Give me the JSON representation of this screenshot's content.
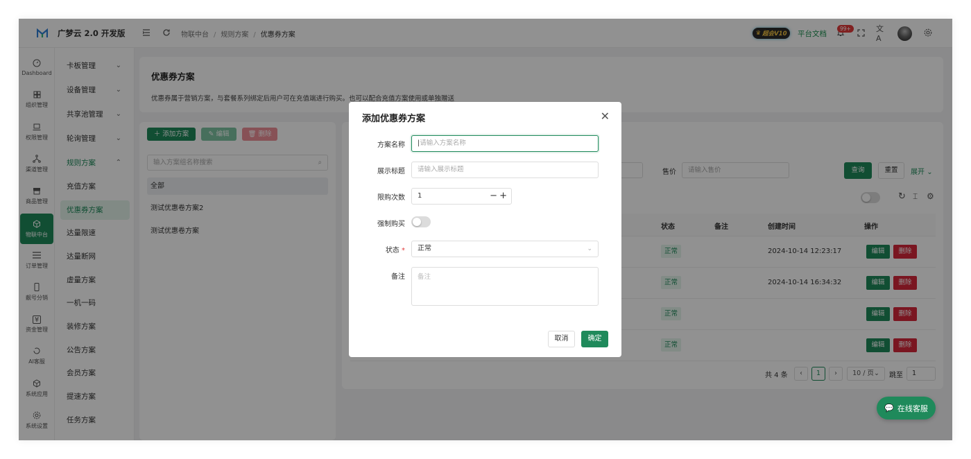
{
  "header": {
    "app_title": "广梦云 2.0 开发版",
    "breadcrumbs": [
      "物联中台",
      "规则方案",
      "优惠券方案"
    ],
    "vip_badge": "超会V10",
    "docs_link": "平台文档",
    "notification_count": "99+"
  },
  "nav": {
    "items": [
      {
        "label": "Dashboard",
        "icon": "dashboard-icon"
      },
      {
        "label": "组织管理",
        "icon": "grid-icon"
      },
      {
        "label": "权限管理",
        "icon": "laptop-icon"
      },
      {
        "label": "渠道管理",
        "icon": "network-icon"
      },
      {
        "label": "商品管理",
        "icon": "store-icon"
      },
      {
        "label": "物联中台",
        "icon": "cube-icon",
        "active": true
      },
      {
        "label": "订单管理",
        "icon": "list-icon"
      },
      {
        "label": "靓号分销",
        "icon": "phone-icon"
      },
      {
        "label": "资金管理",
        "icon": "yuan-icon"
      },
      {
        "label": "AI客服",
        "icon": "ai-icon"
      },
      {
        "label": "系统应用",
        "icon": "box-icon"
      },
      {
        "label": "系统设置",
        "icon": "gear-icon"
      }
    ]
  },
  "submenu": {
    "items": [
      {
        "label": "卡板管理",
        "chevron": "down"
      },
      {
        "label": "设备管理",
        "chevron": "down"
      },
      {
        "label": "共享池管理",
        "chevron": "down"
      },
      {
        "label": "轮询管理",
        "chevron": "down"
      },
      {
        "label": "规则方案",
        "chevron": "up",
        "open": true
      },
      {
        "label": "充值方案"
      },
      {
        "label": "优惠券方案",
        "active": true
      },
      {
        "label": "达量限速"
      },
      {
        "label": "达量断网"
      },
      {
        "label": "虚量方案"
      },
      {
        "label": "一机一码"
      },
      {
        "label": "装修方案"
      },
      {
        "label": "公告方案"
      },
      {
        "label": "会员方案"
      },
      {
        "label": "提速方案"
      },
      {
        "label": "任务方案"
      }
    ]
  },
  "page": {
    "title": "优惠券方案",
    "description": "优惠券属于营销方案，与套餐系列绑定后用户可在充值端进行购买。也可以配合充值方案使用或单独赠送"
  },
  "toolbar": {
    "add_label": "添加方案",
    "edit_label": "编辑",
    "delete_label": "删除"
  },
  "group_panel": {
    "search_placeholder": "输入方案组名称搜索",
    "groups": [
      "全部",
      "测试优惠卷方案2",
      "测试优惠卷方案"
    ]
  },
  "search_form": {
    "price_label": "售价",
    "price_placeholder": "请输入售价",
    "query_label": "查询",
    "reset_label": "重置",
    "expand_label": "展开"
  },
  "table": {
    "columns": [
      "状态",
      "备注",
      "创建时间",
      "操作"
    ],
    "rows": [
      {
        "status": "正常",
        "remark": "",
        "created": "2024-10-14 12:23:17",
        "edit": "编辑",
        "delete": "删除"
      },
      {
        "status": "正常",
        "remark": "",
        "created": "2024-10-14 16:34:32",
        "edit": "编辑",
        "delete": "删除"
      },
      {
        "status": "正常",
        "remark": "",
        "created": "",
        "edit": "编辑",
        "delete": "删除"
      },
      {
        "status": "正常",
        "remark": "",
        "created": "",
        "edit": "编辑",
        "delete": "删除"
      }
    ]
  },
  "pagination": {
    "total_text": "共 4 条",
    "current_page": "1",
    "page_size": "10 / 页",
    "jump_label": "跳至",
    "jump_value": "1"
  },
  "modal": {
    "title": "添加优惠券方案",
    "fields": {
      "name": {
        "label": "方案名称",
        "placeholder": "请输入方案名称"
      },
      "display_title": {
        "label": "展示标题",
        "placeholder": "请输入展示标题"
      },
      "limit": {
        "label": "限购次数",
        "value": "1"
      },
      "force_buy": {
        "label": "强制购买",
        "on": false
      },
      "status": {
        "label": "状态",
        "required_mark": "*",
        "value": "正常"
      },
      "remark": {
        "label": "备注",
        "placeholder": "备注"
      }
    },
    "cancel_label": "取消",
    "ok_label": "确定"
  },
  "chat_button": {
    "label": "在线客服"
  },
  "colors": {
    "primary": "#1f8a5b",
    "danger": "#d6273a",
    "overlay": "rgba(0,0,0,0.43)"
  }
}
